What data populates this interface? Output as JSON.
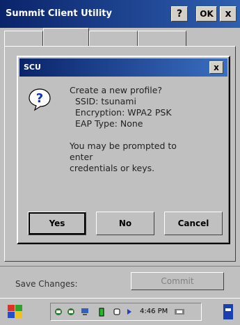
{
  "window": {
    "title": "Summit Client Utility",
    "help_label": "?",
    "ok_label": "OK",
    "close_label": "x"
  },
  "dialog": {
    "title": "SCU",
    "close_label": "x",
    "line1": "Create a new profile?",
    "line2": "SSID: tsunami",
    "line3": "Encryption: WPA2 PSK",
    "line4": "EAP Type: None",
    "line5": "You may be prompted to",
    "line6": "enter",
    "line7": "credentials or keys.",
    "yes_label": "Yes",
    "no_label": "No",
    "cancel_label": "Cancel"
  },
  "footer": {
    "save_label": "Save Changes:",
    "commit_label": "Commit"
  },
  "taskbar": {
    "clock": "4:46 PM"
  },
  "colors": {
    "title_bar": "#0a246a",
    "face": "#c0c0c0"
  }
}
